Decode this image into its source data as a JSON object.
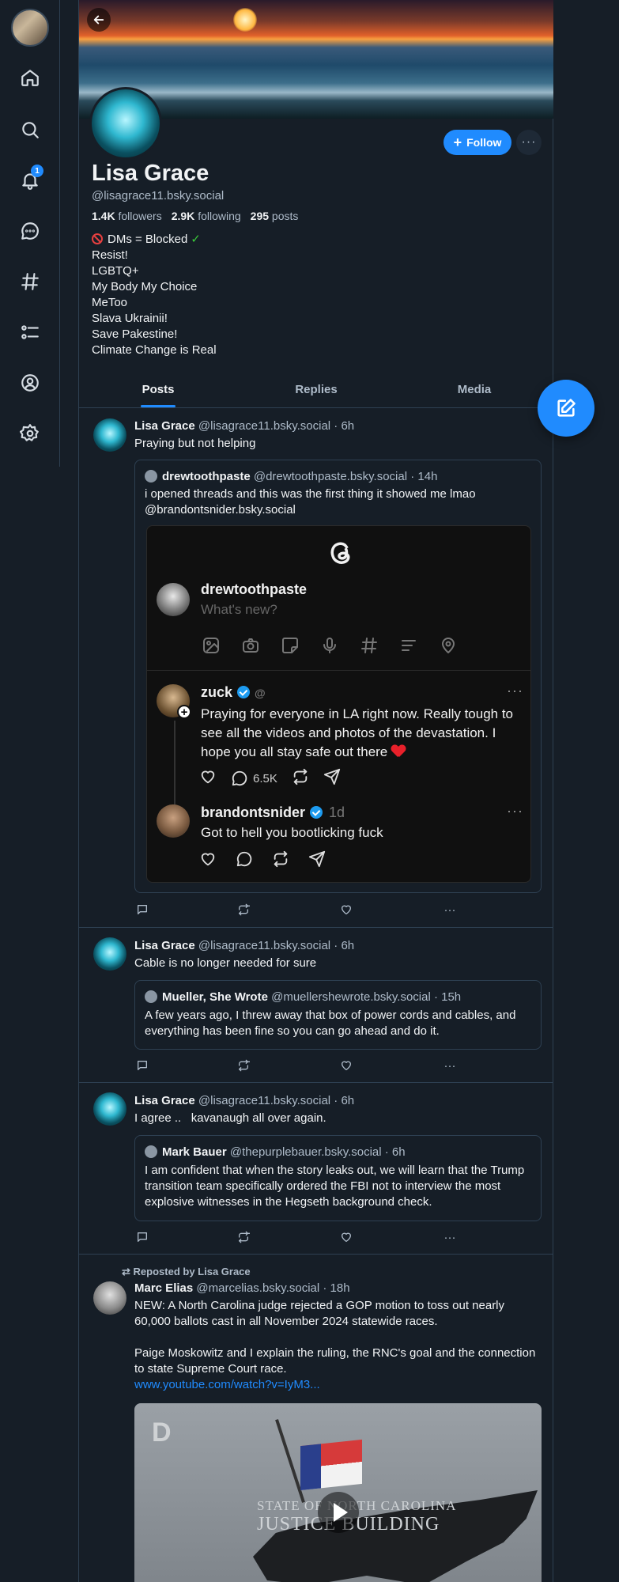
{
  "nav": {
    "notification_count": "1"
  },
  "profile": {
    "name": "Lisa Grace",
    "handle": "@lisagrace11.bsky.social",
    "followers_count": "1.4K",
    "followers_label": "followers",
    "following_count": "2.9K",
    "following_label": "following",
    "posts_count": "295",
    "posts_label": "posts",
    "follow_label": "Follow",
    "bio_first": "DMs = Blocked",
    "bio": [
      "Resist!",
      "LGBTQ+",
      "My Body My Choice",
      "MeToo",
      "Slava Ukrainii!",
      "Save Pakestine!",
      "Climate Change is Real"
    ]
  },
  "tabs": [
    "Posts",
    "Replies",
    "Media"
  ],
  "posts": [
    {
      "name": "Lisa Grace",
      "meta": "@lisagrace11.bsky.social · 6h",
      "text": "Praying but not helping",
      "quote": {
        "name": "drewtoothpaste",
        "meta": "@drewtoothpaste.bsky.social · 14h",
        "text": "i opened threads and this was the first thing it showed me lmao @brandontsnider.bsky.social",
        "embed": {
          "composer_name": "drewtoothpaste",
          "composer_placeholder": "What's new?",
          "reply1_name": "zuck",
          "reply1_text": "Praying for everyone in LA right now. Really tough to see all the videos and photos of the devastation. I hope you all stay safe out there",
          "reply1_comments": "6.5K",
          "reply2_name": "brandontsnider",
          "reply2_time": "1d",
          "reply2_text": "Got to hell you bootlicking fuck"
        }
      }
    },
    {
      "name": "Lisa Grace",
      "meta": "@lisagrace11.bsky.social · 6h",
      "text": "Cable is no longer needed for sure",
      "quote": {
        "name": "Mueller, She Wrote",
        "meta": "@muellershewrote.bsky.social · 15h",
        "text": "A few years ago, I threw away that box of power cords and cables, and everything has been fine so you can go ahead and do it."
      }
    },
    {
      "name": "Lisa Grace",
      "meta": "@lisagrace11.bsky.social · 6h",
      "text": "I agree ..   kavanaugh all over again.",
      "quote": {
        "name": "Mark Bauer",
        "meta": "@thepurplebauer.bsky.social · 6h",
        "text": "I am confident that when the story leaks out, we will learn that the Trump transition team specifically ordered the FBI not to interview the most explosive witnesses in the Hegseth background check."
      }
    },
    {
      "repost_label": "Reposted by Lisa Grace",
      "name": "Marc Elias",
      "meta": "@marcelias.bsky.social · 18h",
      "text1": "NEW: A North Carolina judge rejected a GOP motion to toss out nearly 60,000 ballots cast in all November 2024 statewide races.",
      "text2": "Paige Moskowitz and I explain the ruling, the RNC's goal and the connection to state Supreme Court race.",
      "link": "www.youtube.com/watch?v=IyM3...",
      "video_text1": "STATE OF NORTH CAROLINA",
      "video_text2": "JUSTICE BUILDING",
      "video_watermark": "D"
    }
  ],
  "colors": {
    "accent": "#208bfe",
    "background": "#161e27",
    "border": "#2e4052",
    "muted": "#aebbc9"
  }
}
